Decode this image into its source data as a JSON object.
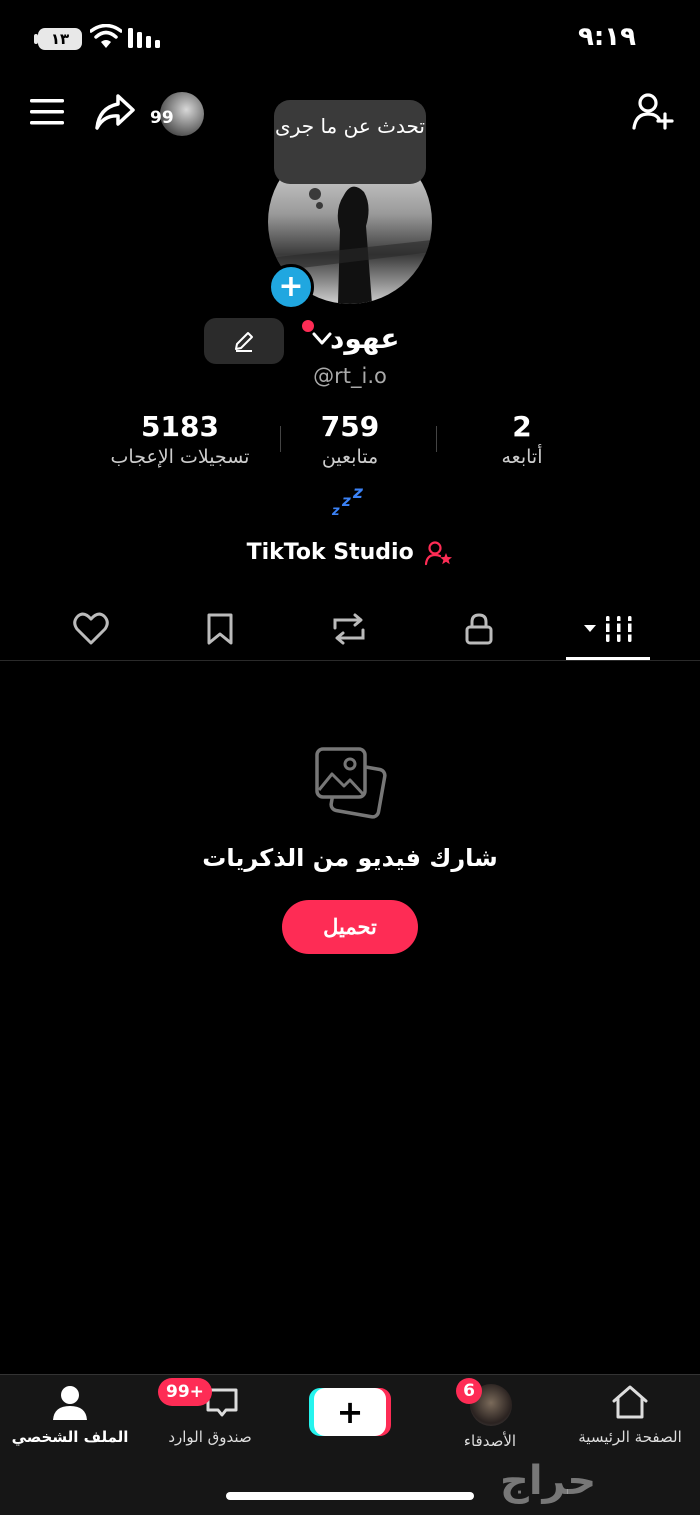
{
  "status_bar": {
    "time": "٩:١٩",
    "battery": "١٣"
  },
  "header": {
    "story_count": "99"
  },
  "profile": {
    "note_bubble": "تحدث عن ما جرى",
    "display_name": "عهود",
    "username": "@rt_i.o",
    "stats": [
      {
        "value": "5183",
        "label": "تسجيلات الإعجاب"
      },
      {
        "value": "759",
        "label": "متابعين"
      },
      {
        "value": "2",
        "label": "أتابعه"
      }
    ],
    "studio_label": "TikTok Studio"
  },
  "empty_state": {
    "title": "شارك فيديو من الذكريات",
    "button": "تحميل"
  },
  "bottom_nav": {
    "profile": "الملف الشخصي",
    "inbox": "صندوق الوارد",
    "inbox_badge": "99+",
    "friends": "الأصدقاء",
    "friends_badge": "6",
    "home": "الصفحة الرئيسية"
  },
  "watermark": "حراج",
  "colors": {
    "accent": "#fe2c55",
    "badge_blue": "#20a7e0",
    "background": "#000000"
  }
}
